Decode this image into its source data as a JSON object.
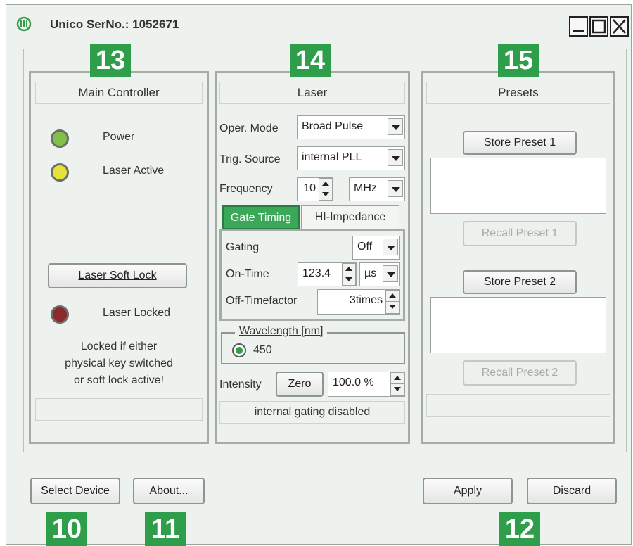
{
  "window": {
    "title": "Unico   SerNo.: 1052671"
  },
  "badges": {
    "main_controller": "13",
    "laser": "14",
    "presets": "15",
    "select_device": "10",
    "about": "11",
    "apply_discard": "12"
  },
  "main_controller": {
    "title": "Main Controller",
    "power_label": "Power",
    "laser_active_label": "Laser Active",
    "soft_lock_button": "Laser Soft Lock",
    "laser_locked_label": "Laser Locked",
    "lock_note_line1": "Locked if either",
    "lock_note_line2": "physical key switched",
    "lock_note_line3": "or soft lock active!",
    "footer_status": "",
    "colors": {
      "power": "#7fc04a",
      "laser_active": "#e6e23a",
      "laser_locked": "#8a2a2a"
    }
  },
  "laser": {
    "title": "Laser",
    "oper_mode_label": "Oper. Mode",
    "oper_mode_value": "Broad Pulse",
    "trig_source_label": "Trig. Source",
    "trig_source_value": "internal PLL",
    "frequency_label": "Frequency",
    "frequency_value": "10",
    "frequency_unit": "MHz",
    "tabs": [
      {
        "label": "Gate Timing",
        "active": true
      },
      {
        "label": "HI-Impedance",
        "active": false
      }
    ],
    "gating_label": "Gating",
    "gating_value": "Off",
    "on_time_label": "On-Time",
    "on_time_value": "123.4",
    "on_time_unit": "µs",
    "off_timefactor_label": "Off-Timefactor",
    "off_timefactor_value": "3times",
    "wavelength_legend": "Wavelength [nm]",
    "wavelength_option": "450",
    "intensity_label": "Intensity",
    "zero_button": "Zero",
    "intensity_value": "100.0 %",
    "status": "internal gating disabled"
  },
  "presets": {
    "title": "Presets",
    "store1": "Store Preset 1",
    "recall1": "Recall Preset 1",
    "store2": "Store Preset 2",
    "recall2": "Recall Preset 2",
    "footer_status": ""
  },
  "bottom": {
    "select_device": "Select Device",
    "about": "About...",
    "apply": "Apply",
    "discard": "Discard"
  },
  "colors": {
    "accent_green": "#2e9e4a",
    "tab_active": "#3aa858"
  }
}
